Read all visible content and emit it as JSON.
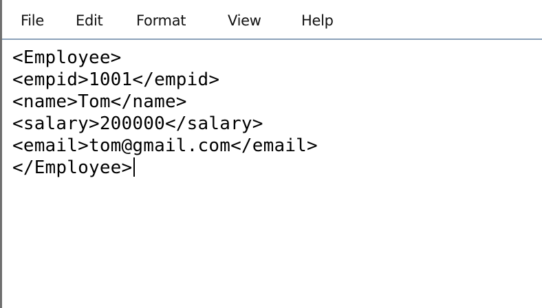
{
  "menu": {
    "items": [
      {
        "label": "File"
      },
      {
        "label": "Edit"
      },
      {
        "label": "Format"
      },
      {
        "label": "View"
      },
      {
        "label": "Help"
      }
    ]
  },
  "editor": {
    "lines": [
      "<Employee>",
      "<empid>1001</empid>",
      "<name>Tom</name>",
      "<salary>200000</salary>",
      "<email>tom@gmail.com</email>",
      "</Employee>"
    ]
  }
}
